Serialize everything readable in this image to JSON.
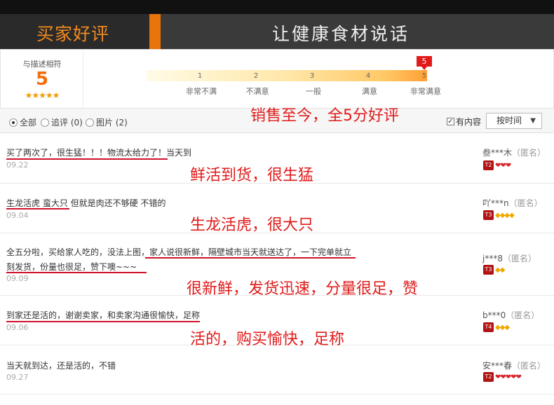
{
  "banner": {
    "title": "买家好评",
    "slogan": "让健康食材说话"
  },
  "rating": {
    "label": "与描述相符",
    "score": "5",
    "stars": "★★★★★",
    "scale_numbers": [
      "1",
      "2",
      "3",
      "4",
      "5"
    ],
    "scale_words": [
      "非常不满",
      "不满意",
      "一般",
      "满意",
      "非常满意"
    ],
    "pin_value": "5",
    "accent_color": "#f36d0a",
    "pin_color": "#e11a1a"
  },
  "filters": {
    "options": [
      {
        "label": "全部",
        "selected": true
      },
      {
        "label": "追评 (0)",
        "selected": false
      },
      {
        "label": "图片 (2)",
        "selected": false
      }
    ],
    "has_content_label": "有内容",
    "has_content_checked": true,
    "sort_label": "按时间"
  },
  "overlays": {
    "summary": "销售至今，全5分好评",
    "r1": "鲜活到货，很生猛",
    "r2": "生龙活虎，很大只",
    "r3": "很新鲜，发货迅速，分量很足，赞",
    "r4": "活的，购买愉快，足称"
  },
  "reviews": [
    {
      "lines": [
        "买了两次了，很生猛！！！物流太给力了！当天到"
      ],
      "date": "09.22",
      "user": "叁***木",
      "anon": "（匿名）",
      "level": "T2",
      "gems": "❤❤❤",
      "gem_color": "red"
    },
    {
      "lines": [
        "生龙活虎 蛮大只 但就是肉还不够硬 不错的"
      ],
      "date": "09.04",
      "user": "吖***n",
      "anon": "（匿名）",
      "level": "T3",
      "gems": "◆◆◆◆",
      "gem_color": "gold"
    },
    {
      "lines": [
        "全五分啦，买给家人吃的，没法上图，家人说很新鲜，隔壁城市当天就送达了，一下完单就立",
        "刻发货，份量也很足，赞下噢~~~"
      ],
      "date": "09.09",
      "user": "j***8",
      "anon": "（匿名）",
      "level": "T3",
      "gems": "◆◆",
      "gem_color": "gold"
    },
    {
      "lines": [
        "到家还是活的，谢谢卖家，和卖家沟通很愉快，足称"
      ],
      "date": "09.06",
      "user": "b***0",
      "anon": "（匿名）",
      "level": "T4",
      "gems": "◆◆◆",
      "gem_color": "gold"
    },
    {
      "lines": [
        "当天就到达，还是活的，不错"
      ],
      "date": "09.27",
      "user": "安***春",
      "anon": "（匿名）",
      "level": "T2",
      "gems": "❤❤❤❤❤",
      "gem_color": "red"
    }
  ]
}
